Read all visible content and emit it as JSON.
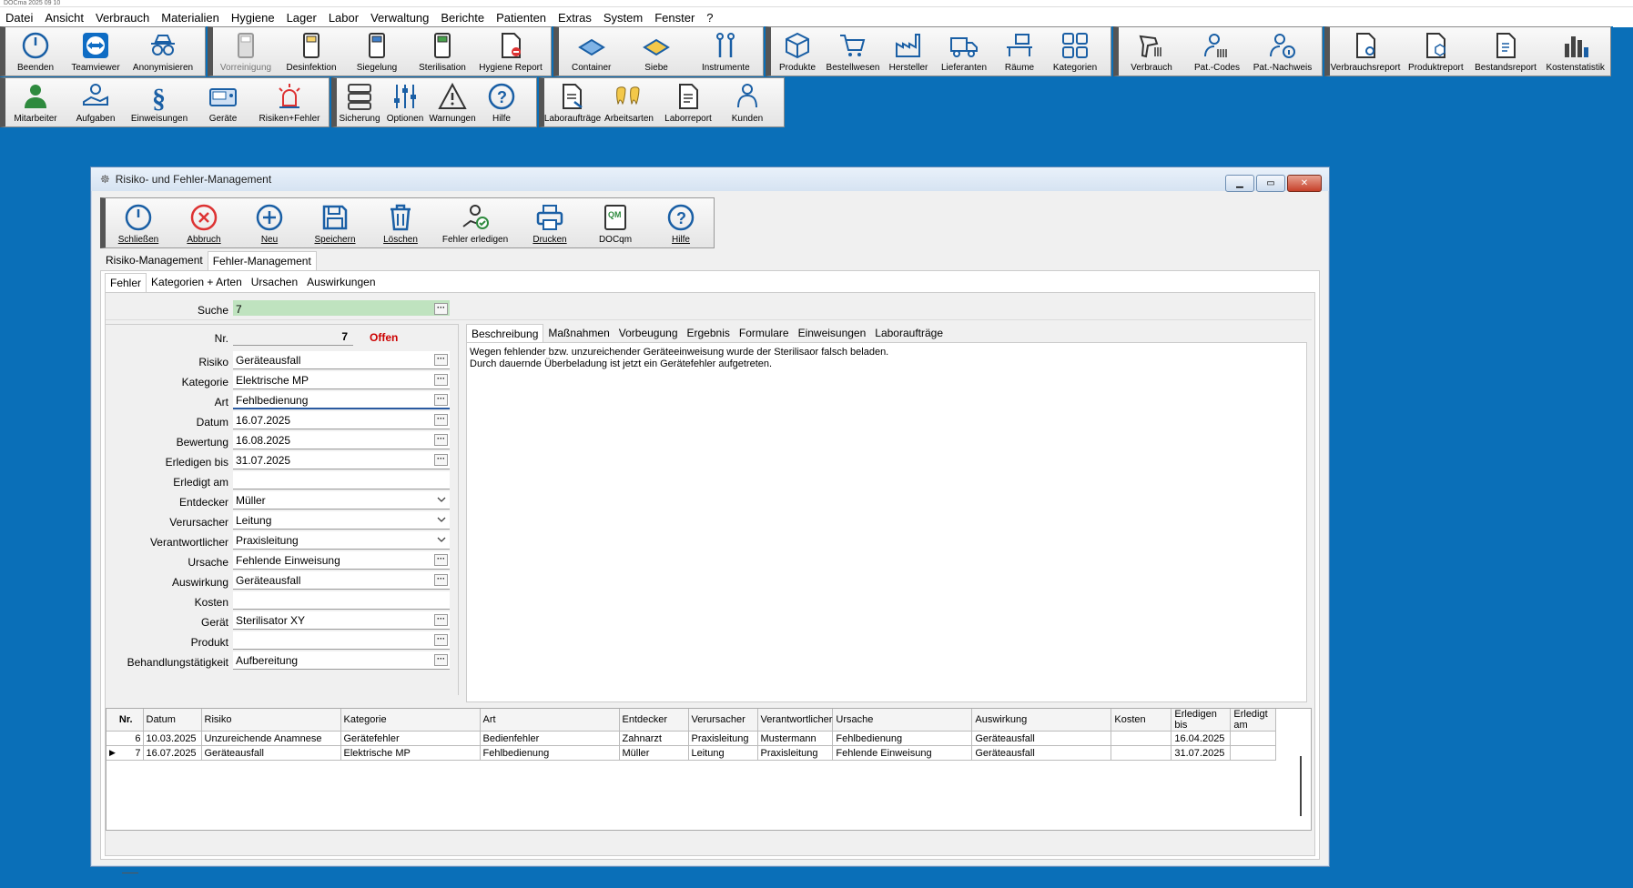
{
  "app_title_strip": "DOCma 2025 09 10",
  "menu": [
    "Datei",
    "Ansicht",
    "Verbrauch",
    "Materialien",
    "Hygiene",
    "Lager",
    "Labor",
    "Verwaltung",
    "Berichte",
    "Patienten",
    "Extras",
    "System",
    "Fenster",
    "?"
  ],
  "toolbar_row1": {
    "g1": [
      "Beenden",
      "Teamviewer",
      "Anonymisieren"
    ],
    "g2": [
      "Vorreinigung",
      "Desinfektion",
      "Siegelung",
      "Sterilisation",
      "Hygiene Report"
    ],
    "g3": [
      "Container",
      "Siebe",
      "Instrumente"
    ],
    "g4": [
      "Produkte",
      "Bestellwesen",
      "Hersteller",
      "Lieferanten",
      "Räume",
      "Kategorien"
    ],
    "g5": [
      "Verbrauch",
      "Pat.-Codes",
      "Pat.-Nachweis"
    ],
    "g6": [
      "Verbrauchsreport",
      "Produktreport",
      "Bestandsreport",
      "Kostenstatistik"
    ]
  },
  "toolbar_row2": {
    "g1": [
      "Mitarbeiter",
      "Aufgaben",
      "Einweisungen",
      "Geräte",
      "Risiken+Fehler"
    ],
    "g2": [
      "Sicherung",
      "Optionen",
      "Warnungen",
      "Hilfe"
    ],
    "g3": [
      "Laboraufträge",
      "Arbeitsarten",
      "Laborreport",
      "Kunden"
    ]
  },
  "window": {
    "title": "Risiko- und Fehler-Management",
    "toolbar": [
      "Schließen",
      "Abbruch",
      "Neu",
      "Speichern",
      "Löschen",
      "Fehler erledigen",
      "Drucken",
      "DOCqm",
      "Hilfe"
    ],
    "main_tabs": [
      "Risiko-Management",
      "Fehler-Management"
    ],
    "sub_tabs": [
      "Fehler",
      "Kategorien + Arten",
      "Ursachen",
      "Auswirkungen"
    ],
    "search_label": "Suche",
    "search_value": "7",
    "nr_label": "Nr.",
    "nr_value": "7",
    "status": "Offen",
    "fields": [
      {
        "label": "Risiko",
        "value": "Geräteausfall",
        "type": "dots"
      },
      {
        "label": "Kategorie",
        "value": "Elektrische MP",
        "type": "dots"
      },
      {
        "label": "Art",
        "value": "Fehlbedienung",
        "type": "dots"
      },
      {
        "label": "Datum",
        "value": "16.07.2025",
        "type": "dots"
      },
      {
        "label": "Bewertung",
        "value": "16.08.2025",
        "type": "dots"
      },
      {
        "label": "Erledigen bis",
        "value": "31.07.2025",
        "type": "dots"
      },
      {
        "label": "Erledigt am",
        "value": "",
        "type": "plain"
      },
      {
        "label": "Entdecker",
        "value": "Müller",
        "type": "drop"
      },
      {
        "label": "Verursacher",
        "value": "Leitung",
        "type": "drop"
      },
      {
        "label": "Verantwortlicher",
        "value": "Praxisleitung",
        "type": "drop"
      },
      {
        "label": "Ursache",
        "value": "Fehlende Einweisung",
        "type": "dots"
      },
      {
        "label": "Auswirkung",
        "value": "Geräteausfall",
        "type": "dots"
      },
      {
        "label": "Kosten",
        "value": "",
        "type": "plain"
      },
      {
        "label": "Gerät",
        "value": "Sterilisator XY",
        "type": "dots"
      },
      {
        "label": "Produkt",
        "value": "",
        "type": "dots"
      },
      {
        "label": "Behandlungstätigkeit",
        "value": "Aufbereitung",
        "type": "dots"
      }
    ],
    "detail_tabs": [
      "Beschreibung",
      "Maßnahmen",
      "Vorbeugung",
      "Ergebnis",
      "Formulare",
      "Einweisungen",
      "Laboraufträge"
    ],
    "description": [
      "Wegen fehlender bzw. unzureichender Geräteeinweisung wurde der Sterilisaor falsch beladen.",
      "Durch dauernde Überbeladung ist jetzt ein Gerätefehler aufgetreten."
    ],
    "grid_headers": [
      "Nr.",
      "Datum",
      "Risiko",
      "Kategorie",
      "Art",
      "Entdecker",
      "Verursacher",
      "Verantwortlicher",
      "Ursache",
      "Auswirkung",
      "Kosten",
      "Erledigen bis",
      "Erledigt am"
    ],
    "grid_rows": [
      [
        "6",
        "10.03.2025",
        "Unzureichende Anamnese",
        "Gerätefehler",
        "Bedienfehler",
        "Zahnarzt",
        "Praxisleitung",
        "Mustermann",
        "Fehlbedienung",
        "Geräteausfall",
        "",
        "16.04.2025",
        ""
      ],
      [
        "7",
        "16.07.2025",
        "Geräteausfall",
        "Elektrische MP",
        "Fehlbedienung",
        "Müller",
        "Leitung",
        "Praxisleitung",
        "Fehlende Einweisung",
        "Geräteausfall",
        "",
        "31.07.2025",
        ""
      ]
    ]
  }
}
